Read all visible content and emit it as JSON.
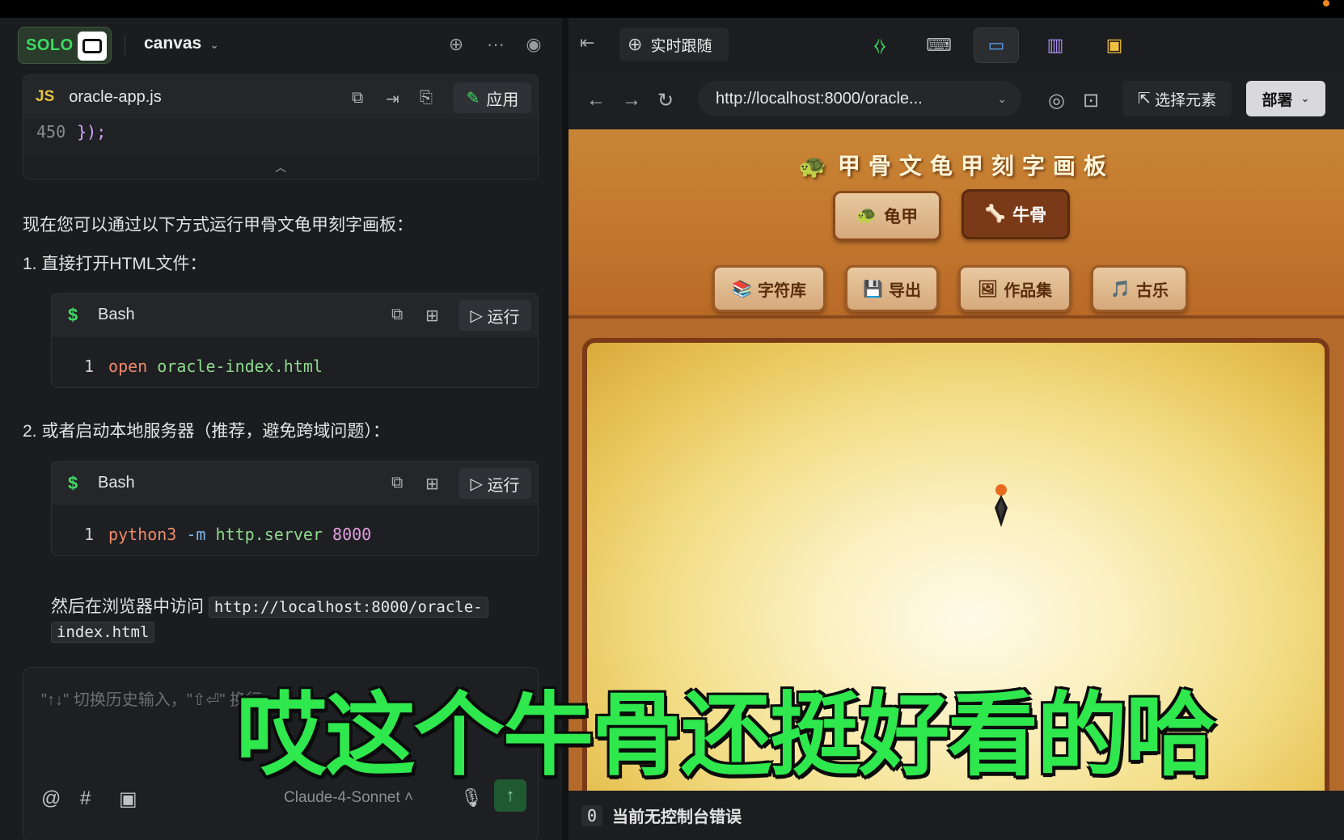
{
  "left": {
    "brand": "SOLO",
    "project": "canvas",
    "file": {
      "lang": "JS",
      "name": "oracle-app.js",
      "apply_label": "应用",
      "line_no": "450",
      "line_code": "});"
    },
    "intro": "现在您可以通过以下方式运行甲骨文龟甲刻字画板：",
    "step1": "1. 直接打开HTML文件：",
    "bash1": {
      "label": "Bash",
      "run_label": "运行",
      "line_no": "1",
      "cmd": "open",
      "arg": "oracle-index.html"
    },
    "step2": "2. 或者启动本地服务器（推荐，避免跨域问题）：",
    "bash2": {
      "label": "Bash",
      "run_label": "运行",
      "line_no": "1",
      "cmd": "python3",
      "flag": "-m",
      "mod": "http.server",
      "port": "8000"
    },
    "visit_text": "然后在浏览器中访问",
    "visit_url_1": "http://localhost:8000/oracle-",
    "visit_url_2": "index.html",
    "input_placeholder": "\"↑↓\" 切换历史输入，\"⇧⏎\" 换行",
    "model": "Claude-4-Sonnet"
  },
  "right": {
    "live_follow": "实时跟随",
    "url": "http://localhost:8000/oracle...",
    "select_element": "选择元素",
    "deploy": "部署",
    "web": {
      "title": "甲骨文龟甲刻字画板",
      "mode_buttons": [
        {
          "icon": "🐢",
          "label": "龟甲"
        },
        {
          "icon": "🦴",
          "label": "牛骨"
        }
      ],
      "tool_buttons": [
        {
          "icon": "📚",
          "label": "字符库"
        },
        {
          "icon": "💾",
          "label": "导出"
        },
        {
          "icon": "🖼",
          "label": "作品集"
        },
        {
          "icon": "🎵",
          "label": "古乐"
        }
      ]
    },
    "console_count": "0",
    "console_text": "当前无控制台错误"
  },
  "subtitle": "哎这个牛骨还挺好看的哈",
  "colors": {
    "accent_green": "#3ddc62",
    "web_brown": "#7a3a18",
    "subtitle_green": "#2ee84e"
  }
}
